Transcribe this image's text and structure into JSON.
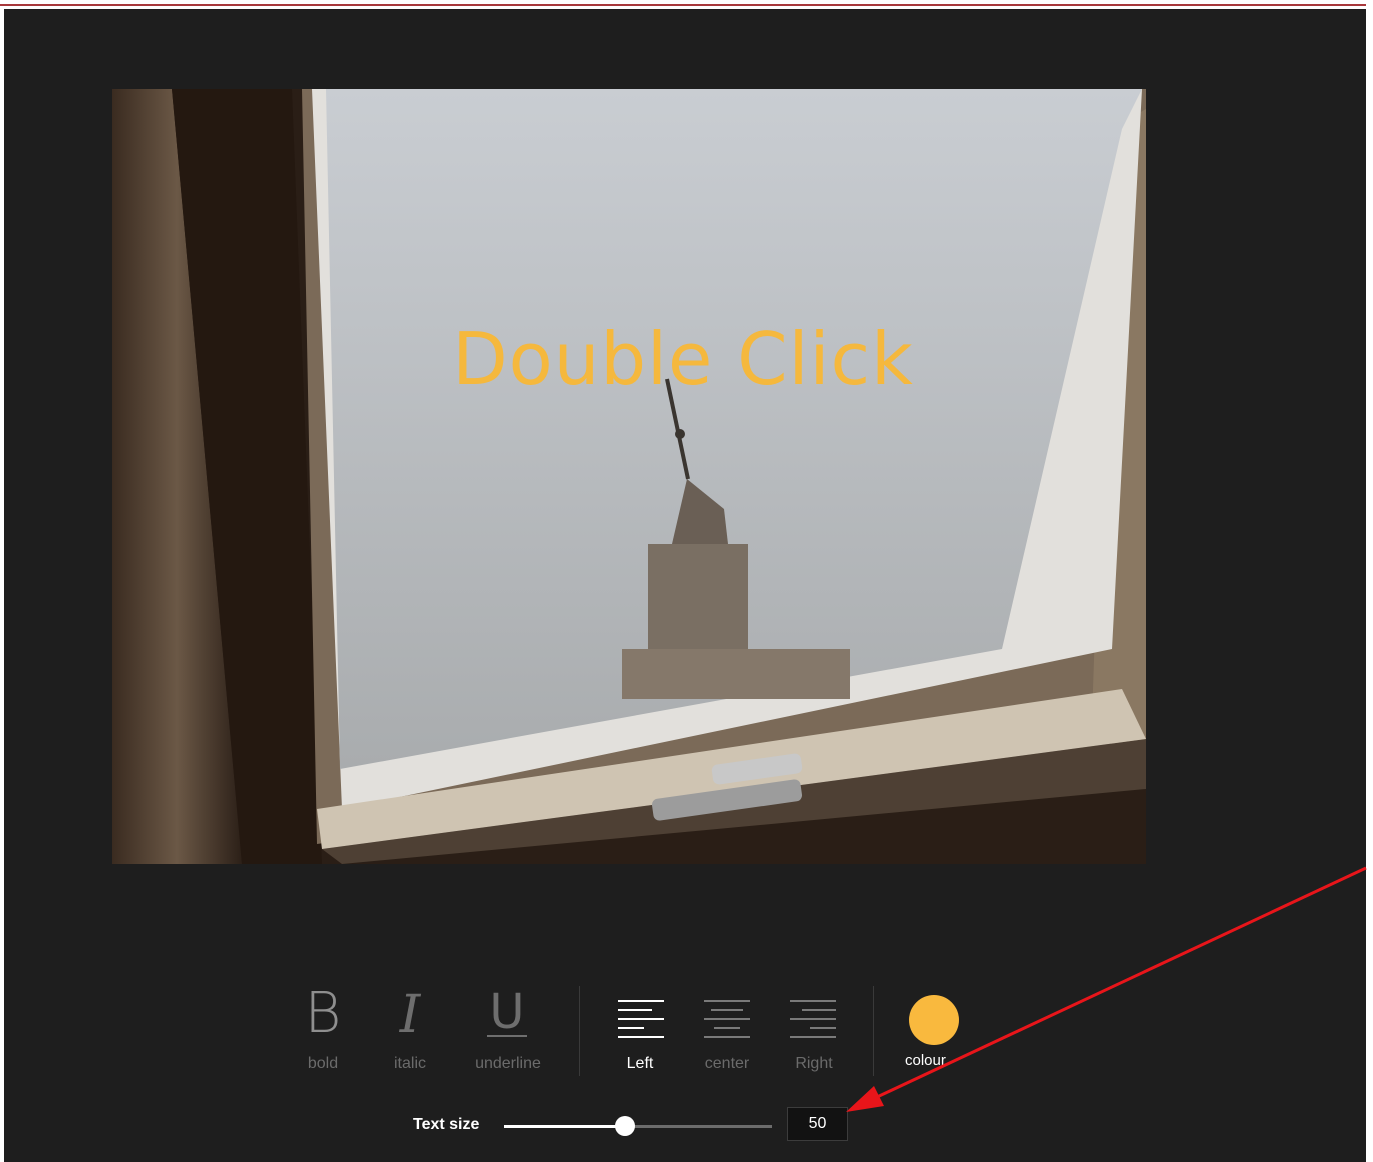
{
  "canvas": {
    "overlay_text": "Double Click",
    "overlay_color": "#f5b83d"
  },
  "toolbar": {
    "style_buttons": [
      {
        "glyph": "B",
        "label": "bold",
        "icon": "bold-icon"
      },
      {
        "glyph": "I",
        "label": "italic",
        "icon": "italic-icon"
      },
      {
        "glyph": "U",
        "label": "underline",
        "icon": "underline-icon"
      }
    ],
    "align_buttons": [
      {
        "label": "Left",
        "icon": "align-left-icon",
        "active": true
      },
      {
        "label": "center",
        "icon": "align-center-icon",
        "active": false
      },
      {
        "label": "Right",
        "icon": "align-right-icon",
        "active": false
      }
    ],
    "colour": {
      "label": "colour",
      "value": "#f9b93e"
    }
  },
  "text_size": {
    "label": "Text size",
    "value": "50",
    "slider_fraction": 0.45
  },
  "colors": {
    "panel_bg": "#1e1e1e",
    "accent": "#f9b93e",
    "annotation_arrow": "#e8151a"
  }
}
